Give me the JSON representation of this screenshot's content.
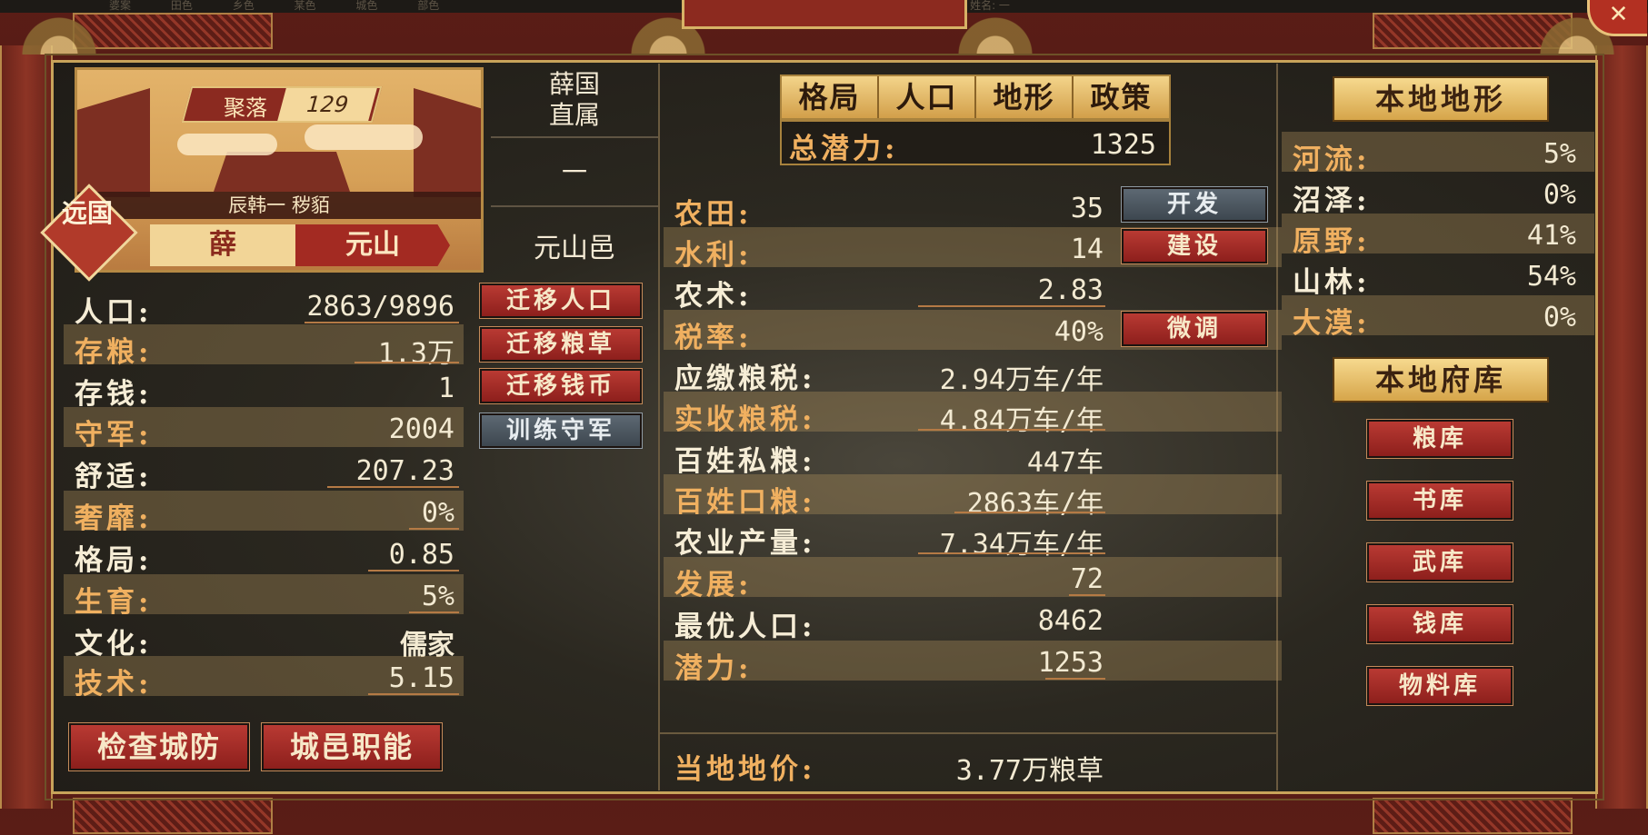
{
  "top_strip": [
    "婆案",
    "田色",
    "乡色",
    "某色",
    "城色",
    "部色",
    "姓名: 一"
  ],
  "window": {
    "title": "",
    "close_label": "✕"
  },
  "city": {
    "settlement_label": "聚落",
    "settlement_value": "129",
    "ruler_text": "辰韩一  秽貊",
    "badge": "远国",
    "state_left": "薛",
    "state_right": "元山"
  },
  "side_info": {
    "affiliation_1": "薛国",
    "affiliation_2": "直属",
    "dash": "一",
    "town": "元山邑"
  },
  "left_stats": [
    {
      "label": "人口:",
      "value": "2863/9896",
      "orange": false,
      "underline": true
    },
    {
      "label": "存粮:",
      "value": "1.3万",
      "orange": true,
      "underline": true
    },
    {
      "label": "存钱:",
      "value": "1",
      "orange": false,
      "underline": false
    },
    {
      "label": "守军:",
      "value": "2004",
      "orange": true,
      "underline": false
    },
    {
      "label": "舒适:",
      "value": "207.23",
      "orange": false,
      "underline": true
    },
    {
      "label": "奢靡:",
      "value": "0%",
      "orange": true,
      "underline": true
    },
    {
      "label": "格局:",
      "value": "0.85",
      "orange": false,
      "underline": true
    },
    {
      "label": "生育:",
      "value": "5%",
      "orange": true,
      "underline": true
    },
    {
      "label": "文化:",
      "value": "儒家",
      "orange": false,
      "underline": false
    },
    {
      "label": "技术:",
      "value": "5.15",
      "orange": true,
      "underline": true
    }
  ],
  "left_actions": [
    "迁移人口",
    "迁移粮草",
    "迁移钱币",
    "训练守军"
  ],
  "bottom_buttons": [
    "检查城防",
    "城邑职能"
  ],
  "tabs": [
    "格局",
    "人口",
    "地形",
    "政策"
  ],
  "potential": {
    "label": "总潜力:",
    "value": "1325"
  },
  "mid_stats": [
    {
      "label": "农田:",
      "value": "35",
      "orange": false,
      "underline": false
    },
    {
      "label": "水利:",
      "value": "14",
      "orange": true,
      "underline": false
    },
    {
      "label": "农术:",
      "value": "2.83",
      "orange": false,
      "underline": true
    },
    {
      "label": "税率:",
      "value": "40%",
      "orange": true,
      "underline": false
    },
    {
      "label": "应缴粮税:",
      "value": "2.94万车/年",
      "orange": false,
      "underline": false
    },
    {
      "label": "实收粮税:",
      "value": "4.84万车/年",
      "orange": true,
      "underline": true
    },
    {
      "label": "百姓私粮:",
      "value": "447车",
      "orange": false,
      "underline": false
    },
    {
      "label": "百姓口粮:",
      "value": "2863车/年",
      "orange": true,
      "underline": true
    },
    {
      "label": "农业产量:",
      "value": "7.34万车/年",
      "orange": false,
      "underline": true
    },
    {
      "label": "发展:",
      "value": "72",
      "orange": true,
      "underline": true
    },
    {
      "label": "最优人口:",
      "value": "8462",
      "orange": false,
      "underline": false
    },
    {
      "label": "潜力:",
      "value": "1253",
      "orange": true,
      "underline": true
    }
  ],
  "mid_actions": {
    "develop": "开发",
    "build": "建设",
    "adjust": "微调"
  },
  "land_price": {
    "label": "当地地价:",
    "value": "3.77万粮草"
  },
  "terrain": {
    "header": "本地地形",
    "items": [
      {
        "label": "河流:",
        "value": "5%"
      },
      {
        "label": "沼泽:",
        "value": "0%"
      },
      {
        "label": "原野:",
        "value": "41%"
      },
      {
        "label": "山林:",
        "value": "54%"
      },
      {
        "label": "大漠:",
        "value": "0%"
      }
    ]
  },
  "storage": {
    "header": "本地府库",
    "items": [
      "粮库",
      "书库",
      "武库",
      "钱库",
      "物料库"
    ]
  },
  "colors": {
    "accent_gold": "#d6a54a",
    "button_red": "#a32a22",
    "button_gray": "#4a555e",
    "stripe": "#b4965f"
  }
}
